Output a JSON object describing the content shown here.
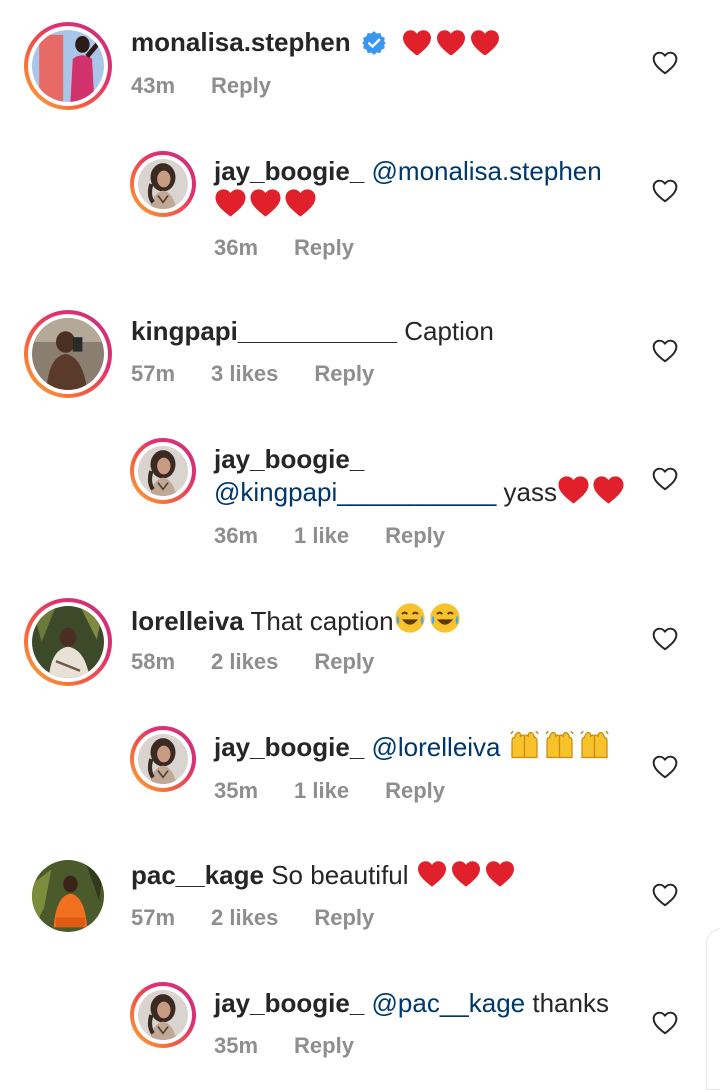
{
  "comments": [
    {
      "id": "c1",
      "username": "monalisa.stephen",
      "verified": true,
      "mention": "",
      "text": "",
      "emoji": "❤️❤️❤️",
      "time": "43m",
      "likes": "",
      "reply_label": "Reply",
      "avatar": "woman-pink-dress"
    },
    {
      "id": "r1",
      "username": "jay_boogie_",
      "mention": "@monalisa.stephen",
      "text": "",
      "emoji": "❤️❤️❤️",
      "time": "36m",
      "likes": "",
      "reply_label": "Reply",
      "avatar": "curly-hair-portrait"
    },
    {
      "id": "c2",
      "username": "kingpapi___________",
      "mention": "",
      "text": "Caption",
      "time": "57m",
      "likes": "3 likes",
      "reply_label": "Reply",
      "avatar": "man-mirror-selfie"
    },
    {
      "id": "r2",
      "username": "jay_boogie_",
      "mention": "@kingpapi___________",
      "text": "yass",
      "emoji": "❤️❤️",
      "time": "36m",
      "likes": "1 like",
      "reply_label": "Reply",
      "avatar": "curly-hair-portrait"
    },
    {
      "id": "c3",
      "username": "lorelleiva",
      "mention": "",
      "text": "That caption",
      "emoji": "😂😂",
      "time": "58m",
      "likes": "2 likes",
      "reply_label": "Reply",
      "avatar": "woman-in-foliage"
    },
    {
      "id": "r3",
      "username": "jay_boogie_",
      "mention": "@lorelleiva",
      "text": "",
      "emoji": "🙌🙌🙌",
      "time": "35m",
      "likes": "1 like",
      "reply_label": "Reply",
      "avatar": "curly-hair-portrait"
    },
    {
      "id": "c4",
      "username": "pac__kage",
      "mention": "",
      "text": "So beautiful",
      "emoji": "❤️❤️❤️",
      "time": "57m",
      "likes": "2 likes",
      "reply_label": "Reply",
      "avatar": "woman-orange-outfit"
    },
    {
      "id": "r4",
      "username": "jay_boogie_",
      "mention": "@pac__kage",
      "text": "thanks",
      "time": "35m",
      "likes": "",
      "reply_label": "Reply",
      "avatar": "curly-hair-portrait"
    }
  ],
  "icons": {
    "like": "heart-outline-icon",
    "verified": "verified-badge-icon"
  },
  "colors": {
    "username": "#262626",
    "mention": "#00376b",
    "meta": "#8e8e8e",
    "verified": "#3897f0",
    "heart_emoji": "#e0202a"
  }
}
